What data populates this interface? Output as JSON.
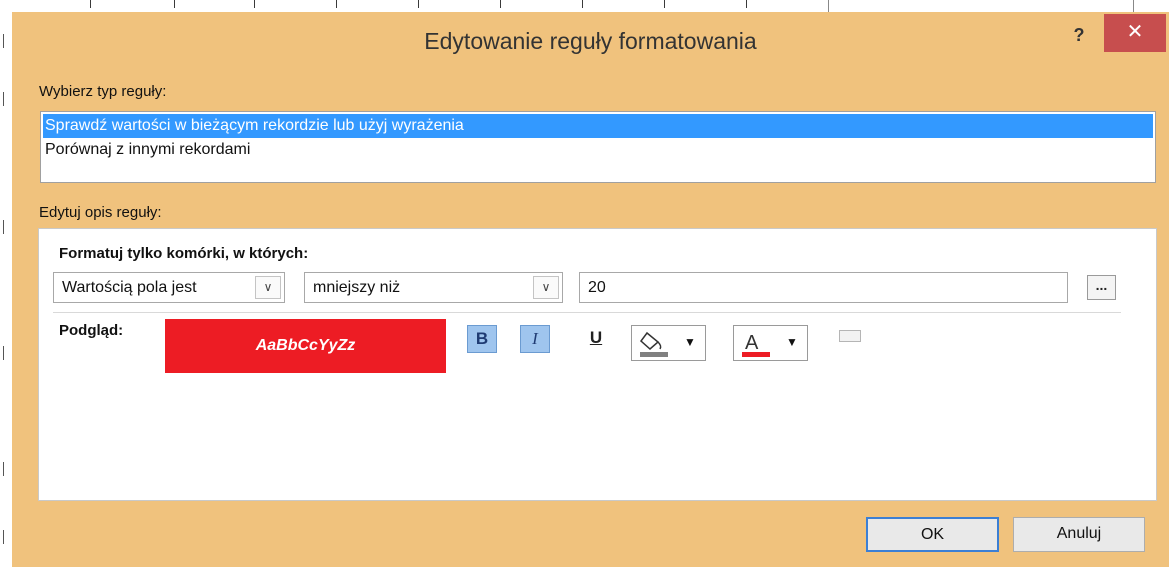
{
  "dialog": {
    "title": "Edytowanie reguły formatowania",
    "help_label": "?",
    "close_label": "✕"
  },
  "rule_type": {
    "label": "Wybierz typ reguły:",
    "items": [
      {
        "label": "Sprawdź wartości w bieżącym rekordzie lub użyj wyrażenia",
        "selected": true
      },
      {
        "label": "Porównaj z innymi rekordami",
        "selected": false
      }
    ]
  },
  "rule_description": {
    "label": "Edytuj opis reguły:",
    "format_label": "Formatuj tylko komórki, w których:",
    "condition_field": "Wartością pola jest",
    "operator": "mniejszy niż",
    "value": "20",
    "ellipsis_label": "...",
    "preview_label": "Podgląd:",
    "preview_sample": "AaBbCcYyZz",
    "bold_label": "B",
    "italic_label": "I",
    "underline_label": "U",
    "fill_color": "#808080",
    "font_color": "#ed1c24",
    "preview_background": "#ed1c24"
  },
  "buttons": {
    "ok": "OK",
    "cancel": "Anuluj"
  },
  "icons": {
    "fill": "paint-bucket-icon",
    "font_color": "font-color-icon",
    "dropdown": "chevron-down-icon"
  }
}
